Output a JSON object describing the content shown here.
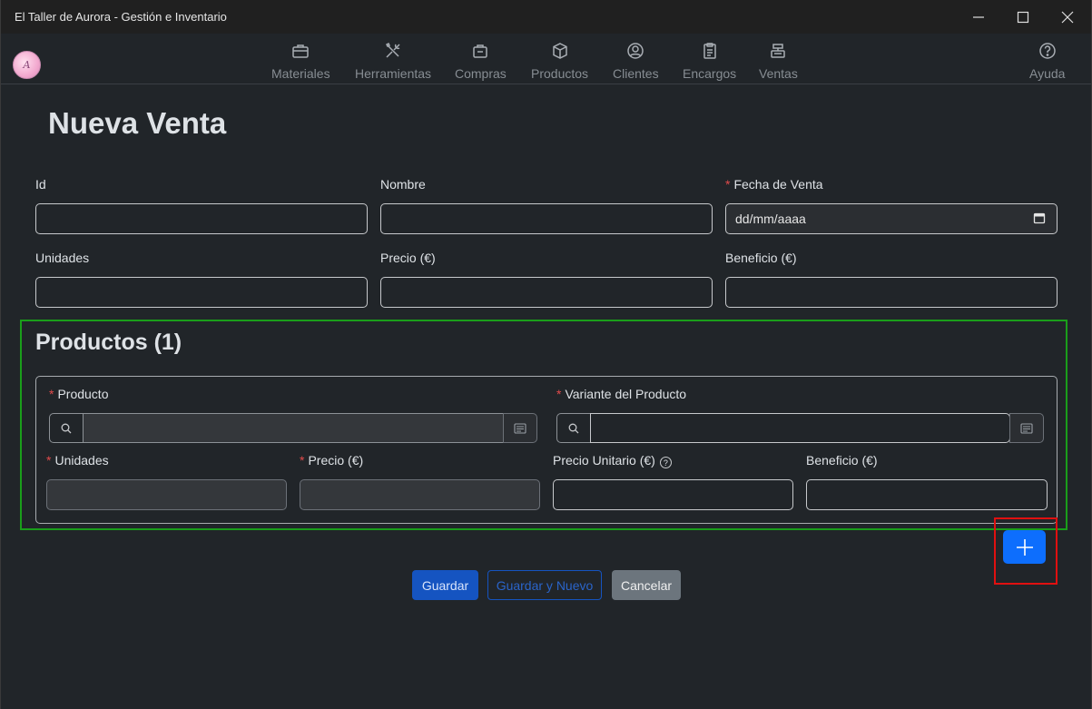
{
  "window": {
    "title": "El Taller de Aurora - Gestión e Inventario"
  },
  "nav": {
    "items": [
      {
        "label": "Materiales",
        "icon": "briefcase-icon"
      },
      {
        "label": "Herramientas",
        "icon": "tools-icon"
      },
      {
        "label": "Compras",
        "icon": "bag-icon"
      },
      {
        "label": "Productos",
        "icon": "box-icon"
      },
      {
        "label": "Clientes",
        "icon": "person-circle-icon"
      },
      {
        "label": "Encargos",
        "icon": "clipboard-icon"
      },
      {
        "label": "Ventas",
        "icon": "cash-register-icon"
      }
    ],
    "help": {
      "label": "Ayuda",
      "icon": "question-circle-icon"
    }
  },
  "page": {
    "title": "Nueva Venta"
  },
  "form": {
    "id_label": "Id",
    "nombre_label": "Nombre",
    "fecha_label": "Fecha de Venta",
    "fecha_placeholder": "dd/mm/aaaa",
    "unidades_label": "Unidades",
    "precio_label": "Precio (€)",
    "beneficio_label": "Beneficio (€)"
  },
  "productos": {
    "title": "Productos (1)",
    "producto_label": "Producto",
    "variante_label": "Variante del Producto",
    "unidades_label": "Unidades",
    "precio_label": "Precio (€)",
    "precio_unitario_label": "Precio Unitario (€)",
    "beneficio_label": "Beneficio (€)"
  },
  "actions": {
    "save": "Guardar",
    "save_new": "Guardar y Nuevo",
    "cancel": "Cancelar"
  },
  "colors": {
    "accent": "#0d6efd",
    "section_outline": "#1a9e1a",
    "highlight": "#e01010"
  }
}
